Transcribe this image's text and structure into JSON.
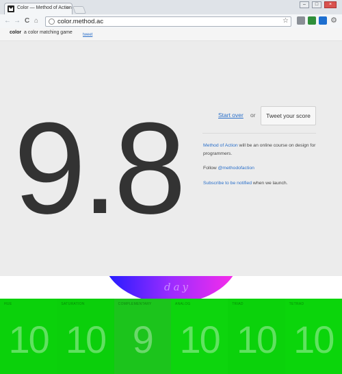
{
  "browser": {
    "tab_title": "Color — Method of Action",
    "tab_close": "×",
    "url": "color.method.ac",
    "win_min": "–",
    "win_max": "□",
    "win_close": "×",
    "back": "←",
    "forward": "→",
    "reload": "C",
    "home": "⌂",
    "star": "☆"
  },
  "header": {
    "brand": "color",
    "tagline": "a color matching game",
    "tweet": "tweet"
  },
  "main": {
    "score": "9.8",
    "start_over": "Start over",
    "or": "or",
    "tweet_score": "Tweet your score",
    "info": {
      "course_link": "Method of Action",
      "course_text": " will be an online course on design for programmers.",
      "follow_prefix": "Follow ",
      "follow_handle": "@methodofaction",
      "subscribe_link": "Subscribe to be notified",
      "subscribe_text": " when we launch."
    }
  },
  "mode": {
    "label": "day",
    "gradient_colors": [
      "#1a1aff",
      "#9c2cff",
      "#ff2ce8"
    ]
  },
  "rounds": [
    {
      "title": "hue",
      "score": "10",
      "color": "#0bd10b"
    },
    {
      "title": "saturation",
      "score": "10",
      "color": "#0bcf0b"
    },
    {
      "title": "complementary",
      "score": "9",
      "color": "#1cc41c"
    },
    {
      "title": "analog",
      "score": "10",
      "color": "#0dd50d"
    },
    {
      "title": "triad",
      "score": "10",
      "color": "#0bd20b"
    },
    {
      "title": "tetrad",
      "score": "10",
      "color": "#0bd50b"
    }
  ]
}
